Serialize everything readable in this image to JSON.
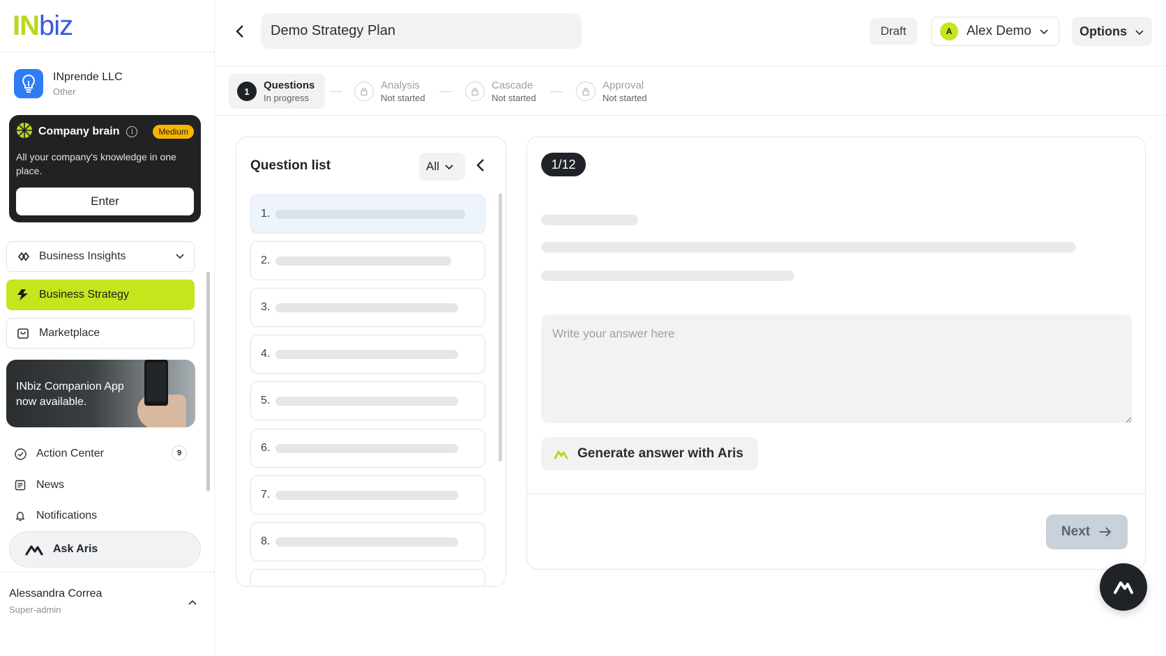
{
  "sidebar": {
    "logo": {
      "part1": "IN",
      "part2": "biz"
    },
    "company": {
      "name": "INprende LLC",
      "type": "Other"
    },
    "brain": {
      "title": "Company brain",
      "badge": "Medium",
      "description": "All your company's knowledge in one place.",
      "button": "Enter"
    },
    "nav": {
      "insights": "Business Insights",
      "strategy": "Business Strategy",
      "marketplace": "Marketplace"
    },
    "promo": {
      "line1": "INbiz Companion App",
      "line2": "now available."
    },
    "links": {
      "action_center": "Action Center",
      "action_center_count": "9",
      "news": "News",
      "notifications": "Notifications"
    },
    "ask": "Ask Aris",
    "user": {
      "name": "Alessandra Correa",
      "role": "Super-admin"
    }
  },
  "header": {
    "title": "Demo Strategy Plan",
    "status": "Draft",
    "user": {
      "initial": "A",
      "name": "Alex Demo"
    },
    "options": "Options"
  },
  "stepper": [
    {
      "num": "1",
      "label": "Questions",
      "status": "In progress"
    },
    {
      "label": "Analysis",
      "status": "Not started"
    },
    {
      "label": "Cascade",
      "status": "Not started"
    },
    {
      "label": "Approval",
      "status": "Not started"
    }
  ],
  "question_list": {
    "title": "Question list",
    "filter": "All",
    "items": [
      "1.",
      "2.",
      "3.",
      "4.",
      "5.",
      "6.",
      "7.",
      "8."
    ]
  },
  "answer": {
    "counter": "1/12",
    "placeholder": "Write your answer here",
    "generate": "Generate answer with Aris",
    "next": "Next"
  },
  "colors": {
    "accent": "#c5e51d",
    "dark": "#1f2328",
    "brand_blue": "#3a5ad8",
    "badge": "#f7b500"
  }
}
